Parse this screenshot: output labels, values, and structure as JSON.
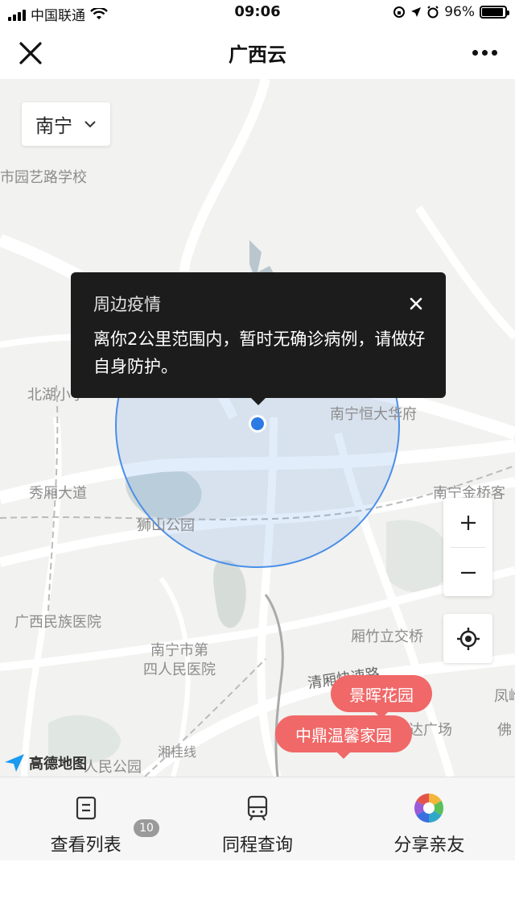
{
  "status_bar": {
    "carrier": "中国联通",
    "time": "09:06",
    "battery": "96%"
  },
  "header": {
    "title": "广西云"
  },
  "map": {
    "city_selector": "南宁",
    "labels": {
      "school": "市园艺路学校",
      "beihu": "北湖小学",
      "xiuxiang": "秀厢大道",
      "shishan": "狮山公园",
      "hengda": "南宁恒大华府",
      "jinqiao": "南宁金桥客",
      "minzu": "广西民族医院",
      "hospital4": "南宁市第\n四人民医院",
      "zhuli": "厢竹立交桥",
      "qingxiu": "清厢快速路",
      "xianggui": "湘桂线",
      "peoplepark": "人民公园",
      "square": "达广场",
      "fo": "佛",
      "feng": "凤岭"
    },
    "popup": {
      "title": "周边疫情",
      "message": "离你2公里范围内，暂时无确诊病例，请做好自身防护。"
    },
    "markers": [
      "景晖花园",
      "中鼎温馨家园"
    ],
    "logo": "高德地图",
    "marker_color": "#f06868",
    "radius_color": "#4a8ee8"
  },
  "bottom_nav": {
    "items": [
      {
        "label": "查看列表",
        "icon": "list-icon",
        "badge": "10"
      },
      {
        "label": "同程查询",
        "icon": "train-icon"
      },
      {
        "label": "分享亲友",
        "icon": "share-aperture-icon"
      }
    ]
  }
}
